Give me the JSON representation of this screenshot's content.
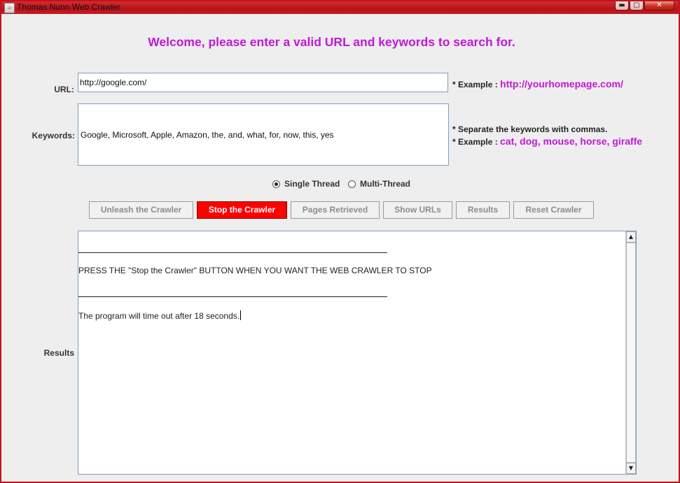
{
  "window": {
    "title": "Thomas Nunn Web Crawler",
    "controls": {
      "minimize": "▬",
      "maximize": "▢",
      "close": "✕"
    }
  },
  "header": {
    "welcome": "Welcome, please enter a valid URL and keywords to search for."
  },
  "form": {
    "url_label": "URL:",
    "url_value": "http://google.com/",
    "url_note_prefix": "* Example :",
    "url_note_example": "http://yourhomepage.com/",
    "keywords_label": "Keywords:",
    "keywords_value": "Google, Microsoft, Apple, Amazon, the, and, what, for, now, this, yes",
    "keywords_note_line1": "*  Separate the keywords with commas.",
    "keywords_note_prefix": "* Example :",
    "keywords_note_example": "cat, dog, mouse, horse, giraffe"
  },
  "threading": {
    "single_label": "Single Thread",
    "multi_label": "Multi-Thread",
    "selected": "single"
  },
  "buttons": {
    "unleash": "Unleash the Crawler",
    "stop": "Stop the Crawler",
    "pages": "Pages Retrieved",
    "show_urls": "Show URLs",
    "results": "Results",
    "reset": "Reset Crawler"
  },
  "results": {
    "label": "Results",
    "line1": "PRESS THE \"Stop the Crawler\" BUTTON WHEN YOU WANT THE WEB CRAWLER TO STOP",
    "line2": "The program will time out after 18 seconds."
  },
  "colors": {
    "accent_purple": "#c218d6",
    "stop_red": "#ff0000",
    "window_border": "#c0141c"
  }
}
